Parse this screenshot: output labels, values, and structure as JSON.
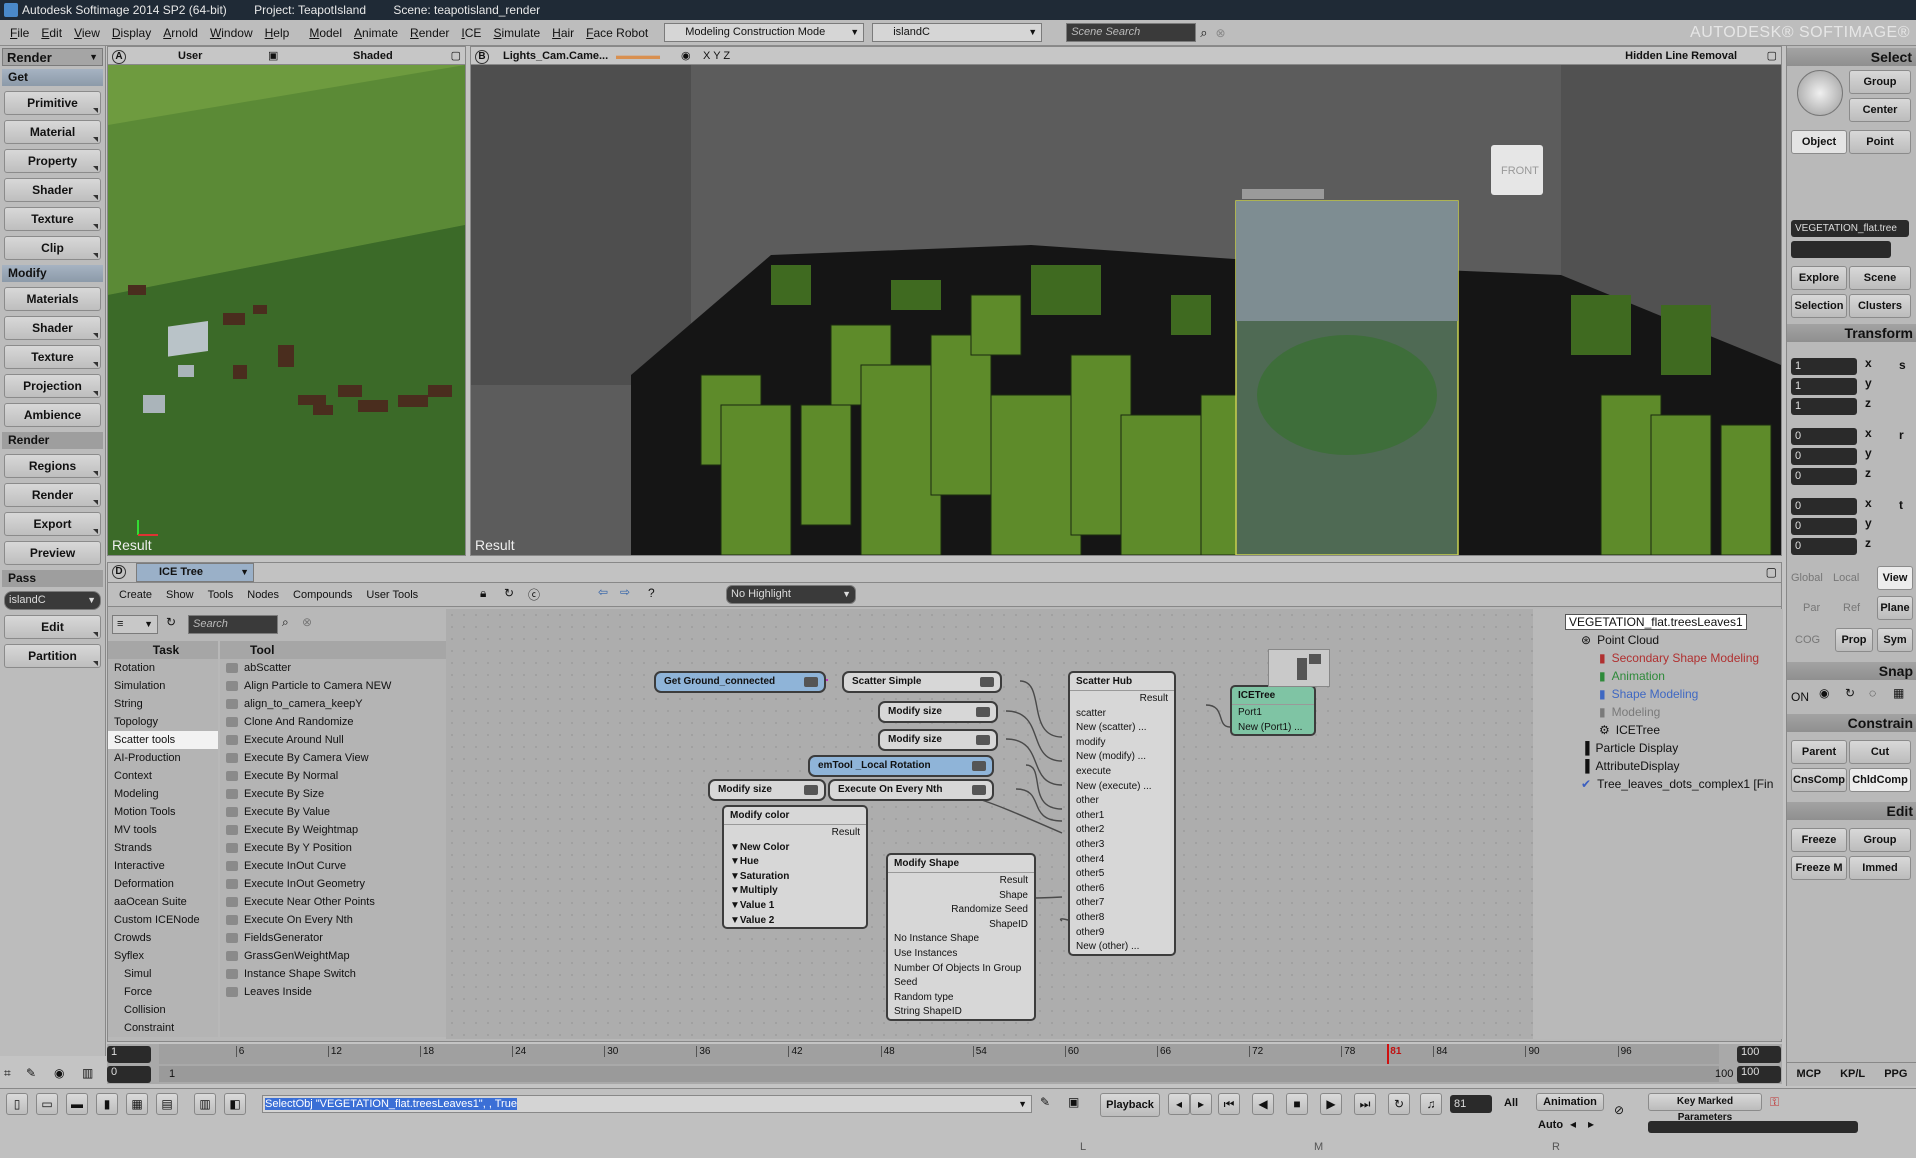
{
  "title": {
    "app": "Autodesk Softimage 2014 SP2 (64-bit)",
    "project": "Project: TeapotIsland",
    "scene": "Scene: teapotisland_render"
  },
  "menu": [
    "File",
    "Edit",
    "View",
    "Display",
    "Arnold",
    "Window",
    "Help",
    "Model",
    "Animate",
    "Render",
    "ICE",
    "Simulate",
    "Hair",
    "Face Robot"
  ],
  "mode_combo": "Modeling Construction Mode",
  "layer_combo": "islandC",
  "scene_search_placeholder": "Scene Search",
  "brand": "AUTODESK® SOFTIMAGE®",
  "left": {
    "combo": "Render",
    "sections": {
      "get": "Get",
      "modify": "Modify",
      "render": "Render",
      "pass": "Pass"
    },
    "get_buttons": [
      "Primitive",
      "Material",
      "Property",
      "Shader",
      "Texture",
      "Clip"
    ],
    "modify_buttons": [
      "Materials",
      "Shader",
      "Texture",
      "Projection",
      "Ambience"
    ],
    "render_buttons": [
      "Regions",
      "Render",
      "Export",
      "Preview"
    ],
    "pass_combo": "islandC",
    "pass_buttons": [
      "Edit",
      "Partition"
    ]
  },
  "viewportA": {
    "letter": "A",
    "camera": "User",
    "shading": "Shaded",
    "result": "Result"
  },
  "viewportB": {
    "letter": "B",
    "camera": "Lights_Cam.Came...",
    "xyz": "X Y Z",
    "shading": "Hidden Line Removal",
    "front": "FRONT",
    "result": "Result"
  },
  "right": {
    "select_title": "Select",
    "group": "Group",
    "center": "Center",
    "object": "Object",
    "point": "Point",
    "selected_name": "VEGETATION_flat.tree",
    "explore": "Explore",
    "scene": "Scene",
    "selection": "Selection",
    "clusters": "Clusters",
    "transform_title": "Transform",
    "scale": [
      "1",
      "1",
      "1"
    ],
    "rotate": [
      "0",
      "0",
      "0"
    ],
    "translate": [
      "0",
      "0",
      "0"
    ],
    "axes": [
      "x",
      "y",
      "z"
    ],
    "trs": [
      "s",
      "r",
      "t"
    ],
    "global": "Global",
    "local": "Local",
    "view": "View",
    "par": "Par",
    "ref": "Ref",
    "plane": "Plane",
    "cog": "COG",
    "prop": "Prop",
    "sym": "Sym",
    "snap_title": "Snap",
    "on": "ON",
    "constrain_title": "Constrain",
    "parent": "Parent",
    "cut": "Cut",
    "cnscomp": "CnsComp",
    "chldcomp": "ChldComp",
    "edit_title": "Edit",
    "freeze": "Freeze",
    "group2": "Group",
    "freeze_m": "Freeze M",
    "immed": "Immed",
    "tabs": [
      "MCP",
      "KP/L",
      "PPG"
    ]
  },
  "ice": {
    "letter": "D",
    "title": "ICE Tree",
    "menu": [
      "Create",
      "Show",
      "Tools",
      "Nodes",
      "Compounds",
      "User Tools"
    ],
    "highlight": "No Highlight",
    "search_placeholder": "Search",
    "task_header": "Task",
    "tool_header": "Tool",
    "tasks": [
      "Rotation",
      "Simulation",
      "String",
      "Topology",
      "Scatter tools",
      "AI-Production",
      "Context",
      "Modeling",
      "Motion Tools",
      "MV tools",
      "Strands",
      "Interactive",
      "Deformation",
      "aaOcean Suite",
      "Custom ICENode",
      "Crowds",
      "Syflex",
      "Simul",
      "Force",
      "Collision",
      "Constraint"
    ],
    "tools": [
      "abScatter",
      "Align Particle to Camera NEW",
      "align_to_camera_keepY",
      "Clone And Randomize",
      "Execute Around Null",
      "Execute By Camera View",
      "Execute By Normal",
      "Execute By Size",
      "Execute By Value",
      "Execute By Weightmap",
      "Execute By Y Position",
      "Execute InOut Curve",
      "Execute InOut Geometry",
      "Execute Near Other Points",
      "Execute On Every Nth",
      "FieldsGenerator",
      "GrassGenWeightMap",
      "Instance Shape Switch",
      "Leaves Inside"
    ],
    "nodes": {
      "get_ground": "Get Ground_connected",
      "scatter_simple": "Scatter Simple",
      "modify_size1": "Modify size",
      "modify_size2": "Modify size",
      "emtool": "emTool _Local Rotation",
      "modify_size3": "Modify size",
      "execute_nth": "Execute On Every Nth",
      "scatter_hub": {
        "title": "Scatter Hub",
        "ports": [
          "Result",
          "scatter",
          "New (scatter) ...",
          "modify",
          "New (modify) ...",
          "execute",
          "New (execute) ...",
          "other",
          "other1",
          "other2",
          "other3",
          "other4",
          "other5",
          "other6",
          "other7",
          "other8",
          "other9",
          "New (other) ..."
        ]
      },
      "icetree": {
        "title": "ICETree",
        "ports": [
          "Port1",
          "New (Port1) ..."
        ]
      },
      "modify_color": {
        "title": "Modify color",
        "ports": [
          "Result",
          "▼New Color",
          "▼Hue",
          "▼Saturation",
          "▼Multiply",
          "▼Value 1",
          "▼Value 2"
        ]
      },
      "modify_shape": {
        "title": "Modify Shape",
        "outputs": [
          "Result",
          "Shape",
          "Randomize Seed",
          "ShapeID"
        ],
        "inputs": [
          "No Instance Shape",
          "Use Instances",
          "Number Of Objects In Group",
          "Seed",
          "Random type",
          "String ShapeID"
        ]
      }
    },
    "explorer": {
      "root": "VEGETATION_flat.treesLeaves1",
      "items": [
        "Point Cloud",
        "Secondary Shape Modeling",
        "Animation",
        "Shape Modeling",
        "Modeling",
        "ICETree",
        "Particle Display",
        "AttributeDisplay",
        "Tree_leaves_dots_complex1 [Fin"
      ]
    },
    "explorer_colors": {
      "secondary": "#b03030",
      "animation": "#2e8a3a",
      "shape_modeling": "#3f68c2",
      "modeling": "#7a7a7a"
    }
  },
  "timeline": {
    "start": "1",
    "start2": "0",
    "start3": "1",
    "end": "100",
    "end2": "100",
    "end3": "100",
    "ticks": [
      "6",
      "12",
      "18",
      "24",
      "30",
      "36",
      "42",
      "48",
      "54",
      "60",
      "66",
      "72",
      "78",
      "81",
      "84",
      "90",
      "96"
    ],
    "current": "81"
  },
  "status": {
    "command": "SelectObj \"VEGETATION_flat.treesLeaves1\", , True",
    "playback": "Playback",
    "frame": "81",
    "all": "All",
    "animation": "Animation",
    "auto": "Auto",
    "key_marked": "Key Marked Parameters",
    "mouse": [
      "L",
      "M",
      "R"
    ]
  },
  "colors": {
    "ice_blue_node": "#8fb4d8",
    "ice_green_node": "#7fc4a4",
    "grass": "#3e6b2a",
    "selection_blue": "#3b6fd6"
  }
}
